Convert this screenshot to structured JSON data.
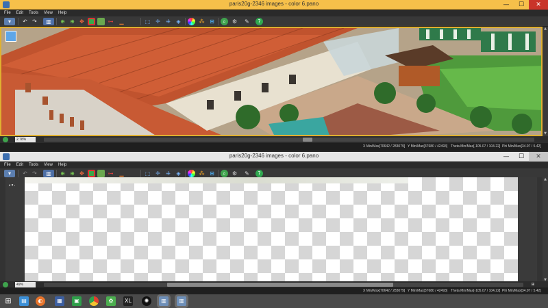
{
  "windows": [
    {
      "title": "paris20g-2346 images - color 6.pano",
      "menu": [
        "File",
        "Edit",
        "Tools",
        "View",
        "Help"
      ],
      "zoom": "2.78%",
      "info": {
        "x": "X Min/Max[70642 / 283079]",
        "y": "Y Min/Max[37680 / 42493]",
        "theta": "Theta Min/Max[-105.07 / 104.22]",
        "phi": "Phi Min/Max[34.97 / 5.42]"
      }
    },
    {
      "title": "paris20g-2346 images - color 6.pano",
      "menu": [
        "File",
        "Edit",
        "Tools",
        "View",
        "Help"
      ],
      "zoom": "49%",
      "info": {
        "x": "X Min/Max[70642 / 283079]",
        "y": "Y Min/Max[37680 / 42493]",
        "theta": "Theta Min/Max[-105.07 / 104.22]",
        "phi": "Phi Min/Max[34.97 / 5.42]"
      }
    }
  ],
  "window_buttons": {
    "minimize": "—",
    "maximize": "☐",
    "close": "✕"
  },
  "colors": {
    "active_title": "#f6c04a",
    "close_active": "#c9342a",
    "panel": "#2f2f2f"
  },
  "toolbar_icons": [
    "menu-button-icon",
    "undo-icon",
    "redo-icon",
    "histogram-icon",
    "crosshair-icon",
    "move-icon",
    "stitch-icon",
    "red-square-icon",
    "horizon-icon",
    "select-icon",
    "expand-icon",
    "grid-icon",
    "globe-icon",
    "color-wheel-icon",
    "mixer-icon",
    "render-icon",
    "zoom-icon",
    "settings-icon",
    "tools-icon",
    "help-icon"
  ],
  "taskbar_icons": [
    "windows-start-icon",
    "file-explorer-icon",
    "firefox-icon",
    "app-icon",
    "media-icon",
    "chrome-icon",
    "green-app-icon",
    "xl-icon",
    "camera-app-icon",
    "pano-window-1-icon",
    "pano-window-2-icon"
  ]
}
